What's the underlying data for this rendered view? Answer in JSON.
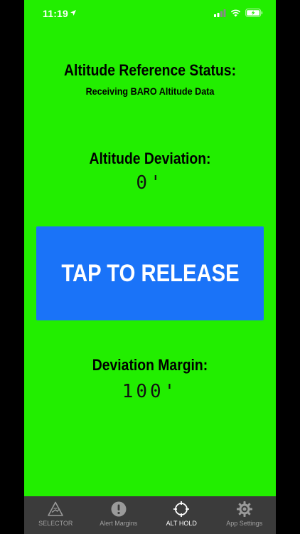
{
  "status_bar": {
    "time": "11:19"
  },
  "reference": {
    "title": "Altitude Reference Status:",
    "subtitle": "Receiving BARO Altitude Data"
  },
  "deviation": {
    "title": "Altitude Deviation:",
    "value": "0'"
  },
  "release_button": {
    "label": "TAP TO RELEASE"
  },
  "margin": {
    "title": "Deviation Margin:",
    "value": "100'"
  },
  "tabs": [
    {
      "label": "SELECTOR",
      "icon": "altitude-selector-icon",
      "active": false
    },
    {
      "label": "Alert Margins",
      "icon": "alert-exclamation-icon",
      "active": false
    },
    {
      "label": "ALT HOLD",
      "icon": "crosshair-icon",
      "active": true
    },
    {
      "label": "App Settings",
      "icon": "gear-icon",
      "active": false
    }
  ],
  "colors": {
    "background": "#22ee00",
    "button": "#1a73f8",
    "tab_bar": "#3b3b3b"
  }
}
